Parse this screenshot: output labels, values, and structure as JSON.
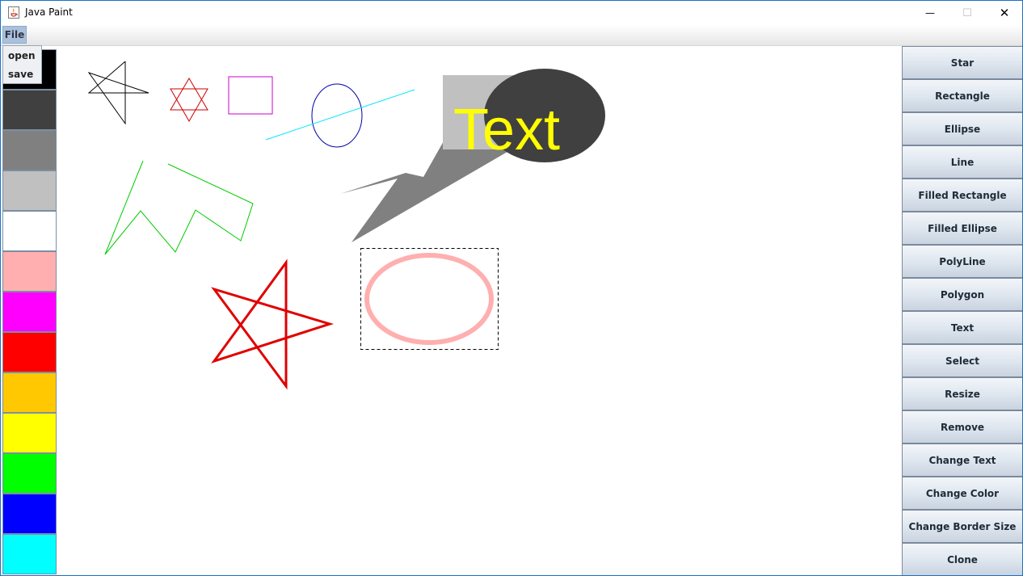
{
  "window": {
    "title": "Java Paint",
    "controls": [
      "—",
      "☐",
      "✕"
    ]
  },
  "menubar": {
    "file_label": "File",
    "file_menu_items": [
      "open",
      "save"
    ]
  },
  "palette": {
    "colors": [
      "#000000",
      "#404040",
      "#808080",
      "#c0c0c0",
      "#ffffff",
      "#ffafaf",
      "#ff00ff",
      "#ff0000",
      "#ffc800",
      "#ffff00",
      "#00ff00",
      "#0000ff",
      "#00ffff"
    ]
  },
  "canvas": {
    "text_shape": "Text",
    "colors": {
      "small_star": "#000000",
      "six_star": "#cc0000",
      "rectangle": "#cc00cc",
      "ellipse": "#0000aa",
      "line": "#00e5ff",
      "polyline": "#00cc00",
      "gray_filled": "#808080",
      "light_gray_filled": "#c0c0c0",
      "dark_ellipse": "#404040",
      "text": "#ffff00",
      "big_star": "#e00000",
      "pink_ellipse": "#ffafaf"
    }
  },
  "toolbar": {
    "buttons": [
      "Star",
      "Rectangle",
      "Ellipse",
      "Line",
      "Filled Rectangle",
      "Filled Ellipse",
      "PolyLine",
      "Polygon",
      "Text",
      "Select",
      "Resize",
      "Remove",
      "Change Text",
      "Change Color",
      "Change Border Size",
      "Clone"
    ]
  }
}
